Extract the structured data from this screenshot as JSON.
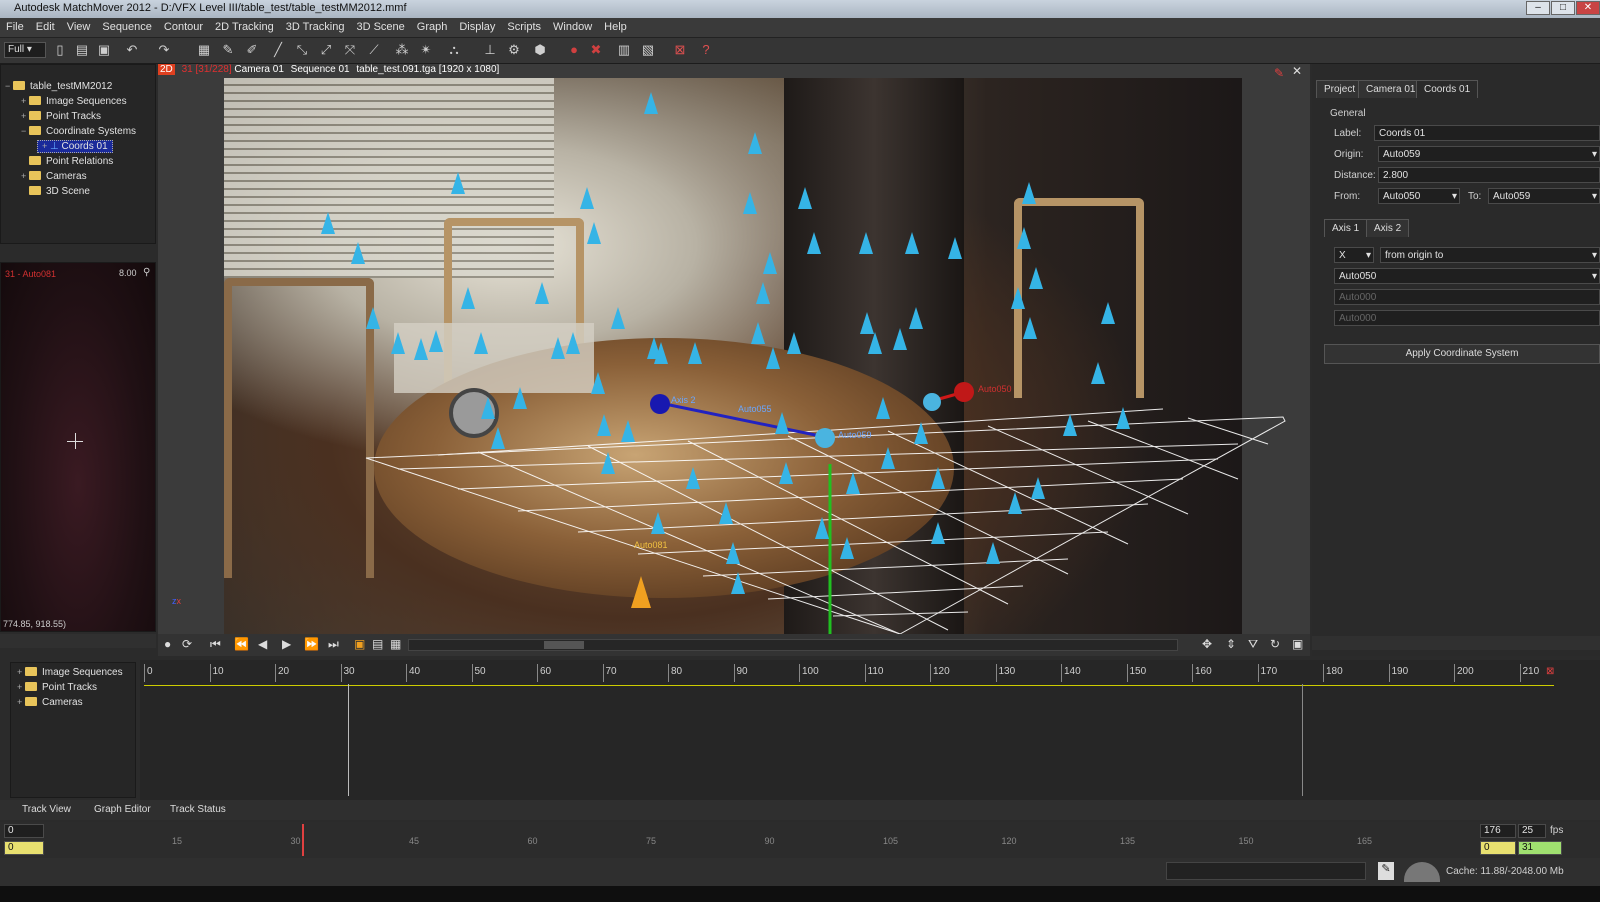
{
  "window": {
    "title": "Autodesk MatchMover 2012 - D:/VFX Level III/table_test/table_testMM2012.mmf"
  },
  "menu": [
    "File",
    "Edit",
    "View",
    "Sequence",
    "Contour",
    "2D Tracking",
    "3D Tracking",
    "3D Scene",
    "Graph",
    "Display",
    "Scripts",
    "Window",
    "Help"
  ],
  "toolbar": {
    "zoom_select": "Full"
  },
  "project_tree": {
    "root": "table_testMM2012",
    "items": [
      "Image Sequences",
      "Point Tracks",
      "Coordinate Systems",
      "Coords 01",
      "Point Relations",
      "Cameras",
      "3D Scene"
    ]
  },
  "mini_view": {
    "title": "31 - Auto081",
    "zoom": "8.00",
    "coords": "774.85, 918.55)"
  },
  "viewport": {
    "mode": "2D",
    "frame": "31",
    "frame_range": "[31/228]",
    "camera": "Camera 01",
    "sequence": "Sequence 01",
    "image": "table_test.091.tga [1920 x 1080]",
    "labels": {
      "axis2": "Axis 2",
      "auto055": "Auto055",
      "auto059": "Auto059",
      "auto050": "Auto050",
      "auto081": "Auto081"
    }
  },
  "right_panel": {
    "tabs": [
      "Project",
      "Camera 01",
      "Coords 01"
    ],
    "section": "General",
    "label_caption": "Label:",
    "label_value": "Coords 01",
    "origin_caption": "Origin:",
    "origin_value": "Auto059",
    "distance_caption": "Distance:",
    "distance_value": "2.800",
    "from_caption": "From:",
    "from_value": "Auto050",
    "to_caption": "To:",
    "to_value": "Auto059",
    "axis_tabs": [
      "Axis 1",
      "Axis 2"
    ],
    "axis_value": "X",
    "axis_mode": "from origin to",
    "axis_point": "Auto050",
    "axis_pt2": "Auto000",
    "axis_pt3": "Auto000",
    "apply_label": "Apply Coordinate System"
  },
  "track_tree": {
    "items": [
      "Image Sequences",
      "Point Tracks",
      "Cameras"
    ]
  },
  "timeline_ticks": [
    "0",
    "10",
    "20",
    "30",
    "40",
    "50",
    "60",
    "70",
    "80",
    "90",
    "100",
    "110",
    "120",
    "130",
    "140",
    "150",
    "160",
    "170",
    "180",
    "190",
    "200",
    "210"
  ],
  "bottom_tabs": [
    "Track View",
    "Graph Editor",
    "Track Status"
  ],
  "scrubber": {
    "start": "0",
    "start2": "0",
    "ticks": [
      "15",
      "30",
      "45",
      "60",
      "75",
      "90",
      "105",
      "120",
      "135",
      "150",
      "165"
    ],
    "end": "176",
    "fps": "25",
    "fps_unit": "fps",
    "end2": "0",
    "current": "31"
  },
  "status": {
    "cache": "Cache: 11.88/-2048.00 Mb"
  },
  "colors": {
    "marker": "#35b4e6",
    "selected_marker": "#f0a020",
    "axis_blue": "#2222c0",
    "axis_red": "#d01818",
    "axis_green": "#20c020"
  }
}
